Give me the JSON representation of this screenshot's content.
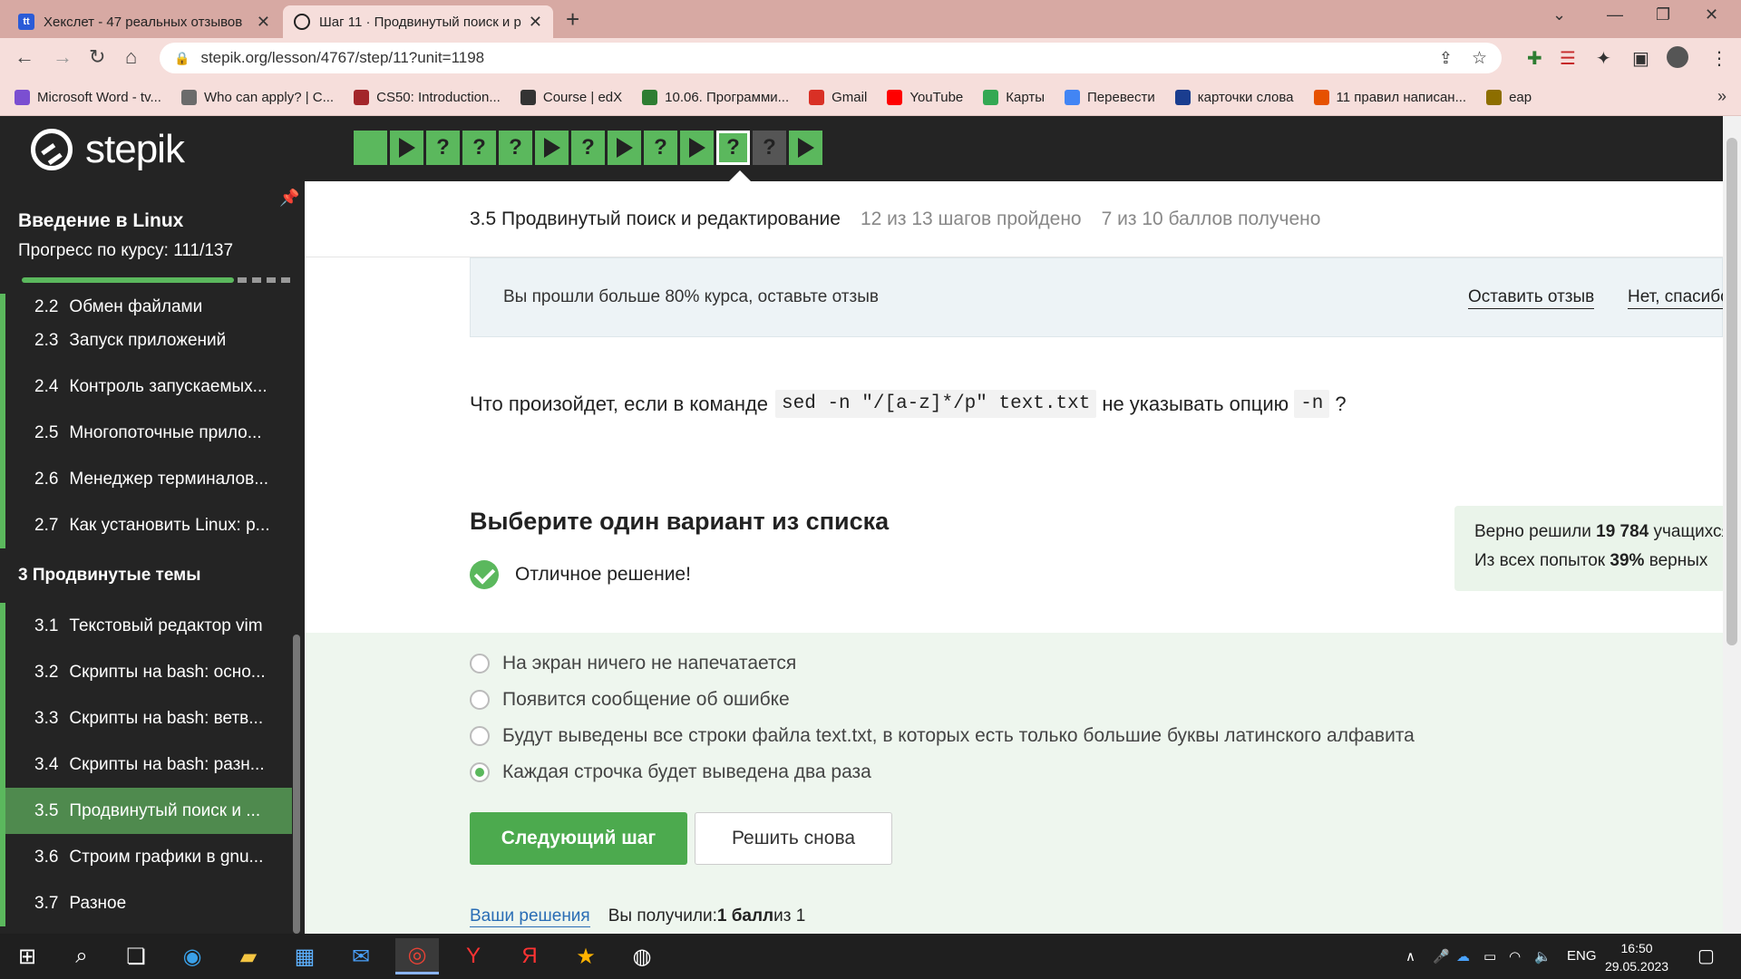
{
  "browser": {
    "tabs": [
      {
        "title": "Хекслет - 47 реальных отзывов",
        "favicon": "tt"
      },
      {
        "title": "Шаг 11 · Продвинутый поиск и р",
        "favicon": "stepik"
      }
    ],
    "url": "stepik.org/lesson/4767/step/11?unit=1198",
    "bookmarks": [
      {
        "label": "Microsoft Word - tv...",
        "color": "#7b4fd1"
      },
      {
        "label": "Who can apply? | C...",
        "color": "#6b6b6b"
      },
      {
        "label": "CS50: Introduction...",
        "color": "#a3262a"
      },
      {
        "label": "Course | edX",
        "color": "#333333"
      },
      {
        "label": "10.06. Программи...",
        "color": "#2e7d32"
      },
      {
        "label": "Gmail",
        "color": "#d93025"
      },
      {
        "label": "YouTube",
        "color": "#ff0000"
      },
      {
        "label": "Карты",
        "color": "#34a853"
      },
      {
        "label": "Перевести",
        "color": "#4285f4"
      },
      {
        "label": "карточки слова",
        "color": "#1a3d8f"
      },
      {
        "label": "11 правил написан...",
        "color": "#e65100"
      },
      {
        "label": "eap",
        "color": "#8d6e00"
      }
    ]
  },
  "header": {
    "logo": "stepik",
    "steps": [
      "done",
      "play",
      "q",
      "q",
      "q",
      "play",
      "q",
      "play",
      "q",
      "play",
      "q-current",
      "q-grey",
      "play"
    ],
    "step_glyph_q": "?"
  },
  "sidebar": {
    "course_title": "Введение в Linux",
    "progress": "Прогресс по курсу:  111/137",
    "items": [
      {
        "num": "2.2",
        "label": "Обмен файлами",
        "cut": true
      },
      {
        "num": "2.3",
        "label": "Запуск приложений"
      },
      {
        "num": "2.4",
        "label": "Контроль запускаемых..."
      },
      {
        "num": "2.5",
        "label": "Многопоточные прило..."
      },
      {
        "num": "2.6",
        "label": "Менеджер терминалов..."
      },
      {
        "num": "2.7",
        "label": "Как установить Linux: р..."
      }
    ],
    "section": "3  Продвинутые темы",
    "items2": [
      {
        "num": "3.1",
        "label": "Текстовый редактор vim"
      },
      {
        "num": "3.2",
        "label": "Скрипты на bash: осно..."
      },
      {
        "num": "3.3",
        "label": "Скрипты на bash: ветв..."
      },
      {
        "num": "3.4",
        "label": "Скрипты на bash: разн..."
      },
      {
        "num": "3.5",
        "label": "Продвинутый поиск и ...",
        "active": true
      },
      {
        "num": "3.6",
        "label": "Строим графики в gnu..."
      },
      {
        "num": "3.7",
        "label": "Разное"
      }
    ]
  },
  "lesson": {
    "title": "3.5 Продвинутый поиск и редактирование",
    "steps_done": "12 из 13 шагов пройдено",
    "points": "7 из 10 баллов  получено"
  },
  "feedback": {
    "text": "Вы прошли больше 80% курса, оставьте отзыв",
    "leave": "Оставить отзыв",
    "no": "Нет, спасибо"
  },
  "question": {
    "before": "Что произойдет, если в команде",
    "code": "sed -n \"/[a-z]*/p\" text.txt",
    "middle": "не указывать опцию",
    "option": "-n",
    "after": "?"
  },
  "quiz": {
    "title": "Выберите один вариант из списка",
    "result": "Отличное решение!",
    "stats_line1_a": "Верно решили ",
    "stats_line1_b": "19 784",
    "stats_line1_c": " учащихся",
    "stats_line2_a": "Из всех попыток ",
    "stats_line2_b": "39%",
    "stats_line2_c": " верных",
    "options": [
      {
        "label": "На экран ничего не напечатается",
        "selected": false
      },
      {
        "label": "Появится сообщение об ошибке",
        "selected": false
      },
      {
        "label": "Будут выведены все строки файла text.txt, в которых есть только большие буквы латинского алфавита",
        "selected": false
      },
      {
        "label": "Каждая строчка будет выведена два раза",
        "selected": true
      }
    ],
    "next": "Следующий шаг",
    "again": "Решить снова",
    "your_solutions": "Ваши решения",
    "score_a": "Вы получили: ",
    "score_b": "1 балл",
    "score_c": " из 1"
  },
  "taskbar": {
    "lang": "ENG",
    "time": "16:50",
    "date": "29.05.2023"
  },
  "colors": {
    "accent": "#5bb85d",
    "dark": "#242424"
  }
}
